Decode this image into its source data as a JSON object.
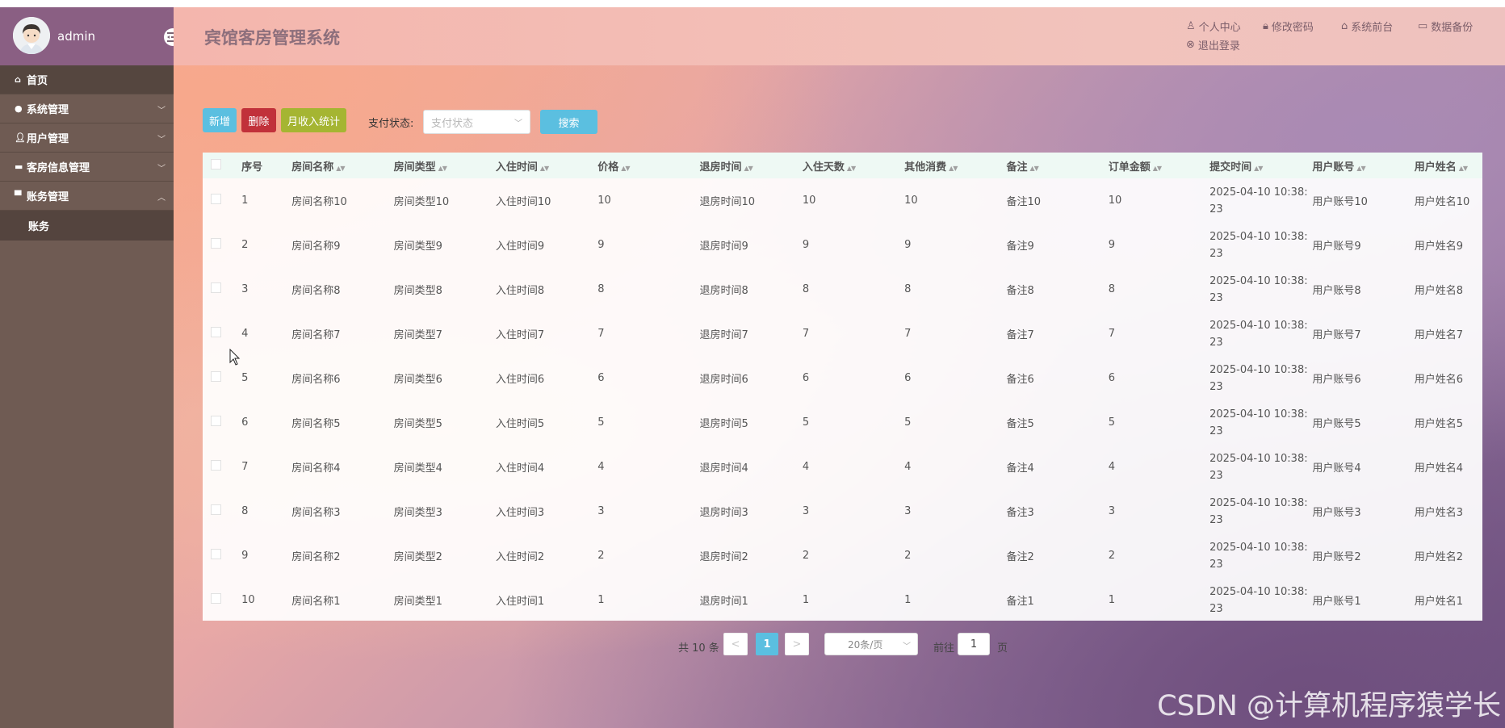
{
  "sidebar": {
    "username": "admin",
    "items": [
      {
        "label": "首页",
        "icon": "home-icon"
      },
      {
        "label": "系统管理",
        "icon": "drop-icon"
      },
      {
        "label": "用户管理",
        "icon": "user-icon"
      },
      {
        "label": "客房信息管理",
        "icon": "bed-icon"
      },
      {
        "label": "账务管理",
        "icon": "ledger-icon"
      }
    ],
    "submenu": {
      "label": "账务"
    }
  },
  "header": {
    "title": "宾馆客房管理系统",
    "links": {
      "profile": "个人中心",
      "password": "修改密码",
      "frontend": "系统前台",
      "backup": "数据备份",
      "logout": "退出登录"
    }
  },
  "toolbar": {
    "add": "新增",
    "delete": "删除",
    "stats": "月收入统计",
    "pay_status_label": "支付状态:",
    "pay_status_placeholder": "支付状态",
    "search": "搜索"
  },
  "table": {
    "columns": [
      "序号",
      "房间名称",
      "房间类型",
      "入住时间",
      "价格",
      "退房时间",
      "入住天数",
      "其他消费",
      "备注",
      "订单金额",
      "提交时间",
      "用户账号",
      "用户姓名"
    ],
    "rows": [
      {
        "no": "1",
        "room": "房间名称10",
        "type": "房间类型10",
        "checkin": "入住时间10",
        "price": "10",
        "checkout": "退房时间10",
        "days": "10",
        "other": "10",
        "note": "备注10",
        "amount": "10",
        "time1": "2025-04-10 10:38:",
        "time2": "23",
        "account": "用户账号10",
        "name": "用户姓名10"
      },
      {
        "no": "2",
        "room": "房间名称9",
        "type": "房间类型9",
        "checkin": "入住时间9",
        "price": "9",
        "checkout": "退房时间9",
        "days": "9",
        "other": "9",
        "note": "备注9",
        "amount": "9",
        "time1": "2025-04-10 10:38:",
        "time2": "23",
        "account": "用户账号9",
        "name": "用户姓名9"
      },
      {
        "no": "3",
        "room": "房间名称8",
        "type": "房间类型8",
        "checkin": "入住时间8",
        "price": "8",
        "checkout": "退房时间8",
        "days": "8",
        "other": "8",
        "note": "备注8",
        "amount": "8",
        "time1": "2025-04-10 10:38:",
        "time2": "23",
        "account": "用户账号8",
        "name": "用户姓名8"
      },
      {
        "no": "4",
        "room": "房间名称7",
        "type": "房间类型7",
        "checkin": "入住时间7",
        "price": "7",
        "checkout": "退房时间7",
        "days": "7",
        "other": "7",
        "note": "备注7",
        "amount": "7",
        "time1": "2025-04-10 10:38:",
        "time2": "23",
        "account": "用户账号7",
        "name": "用户姓名7"
      },
      {
        "no": "5",
        "room": "房间名称6",
        "type": "房间类型6",
        "checkin": "入住时间6",
        "price": "6",
        "checkout": "退房时间6",
        "days": "6",
        "other": "6",
        "note": "备注6",
        "amount": "6",
        "time1": "2025-04-10 10:38:",
        "time2": "23",
        "account": "用户账号6",
        "name": "用户姓名6"
      },
      {
        "no": "6",
        "room": "房间名称5",
        "type": "房间类型5",
        "checkin": "入住时间5",
        "price": "5",
        "checkout": "退房时间5",
        "days": "5",
        "other": "5",
        "note": "备注5",
        "amount": "5",
        "time1": "2025-04-10 10:38:",
        "time2": "23",
        "account": "用户账号5",
        "name": "用户姓名5"
      },
      {
        "no": "7",
        "room": "房间名称4",
        "type": "房间类型4",
        "checkin": "入住时间4",
        "price": "4",
        "checkout": "退房时间4",
        "days": "4",
        "other": "4",
        "note": "备注4",
        "amount": "4",
        "time1": "2025-04-10 10:38:",
        "time2": "23",
        "account": "用户账号4",
        "name": "用户姓名4"
      },
      {
        "no": "8",
        "room": "房间名称3",
        "type": "房间类型3",
        "checkin": "入住时间3",
        "price": "3",
        "checkout": "退房时间3",
        "days": "3",
        "other": "3",
        "note": "备注3",
        "amount": "3",
        "time1": "2025-04-10 10:38:",
        "time2": "23",
        "account": "用户账号3",
        "name": "用户姓名3"
      },
      {
        "no": "9",
        "room": "房间名称2",
        "type": "房间类型2",
        "checkin": "入住时间2",
        "price": "2",
        "checkout": "退房时间2",
        "days": "2",
        "other": "2",
        "note": "备注2",
        "amount": "2",
        "time1": "2025-04-10 10:38:",
        "time2": "23",
        "account": "用户账号2",
        "name": "用户姓名2"
      },
      {
        "no": "10",
        "room": "房间名称1",
        "type": "房间类型1",
        "checkin": "入住时间1",
        "price": "1",
        "checkout": "退房时间1",
        "days": "1",
        "other": "1",
        "note": "备注1",
        "amount": "1",
        "time1": "2025-04-10 10:38:",
        "time2": "23",
        "account": "用户账号1",
        "name": "用户姓名1"
      }
    ]
  },
  "pagination": {
    "total": "共 10 条",
    "prev": "<",
    "current": "1",
    "next": ">",
    "page_size": "20条/页",
    "goto_label": "前往",
    "goto_value": "1",
    "page_suffix": "页"
  },
  "watermark": "CSDN @计算机程序猿学长",
  "colors": {
    "accent": "#5bbfe0",
    "danger": "#c1313a",
    "stats": "#a5b532",
    "sidebar": "#6f5b53"
  }
}
